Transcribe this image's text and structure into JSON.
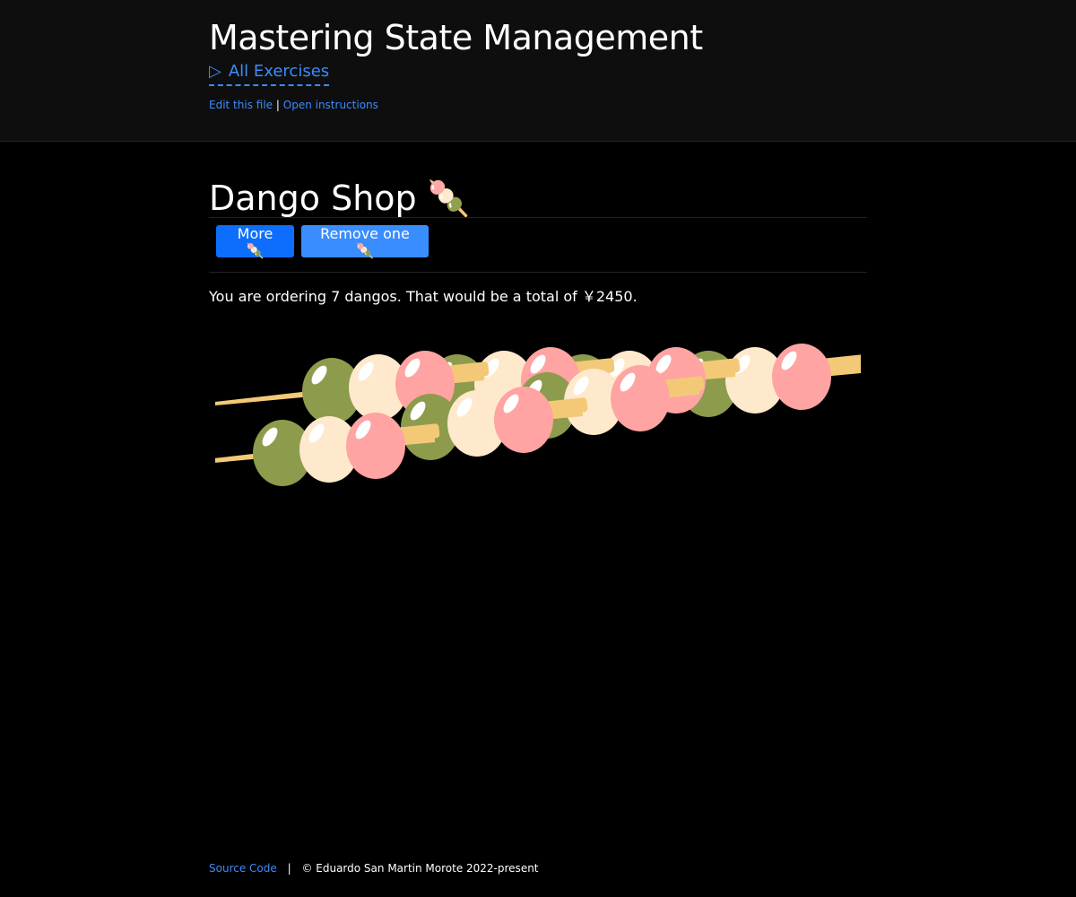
{
  "header": {
    "title": "Mastering State Management",
    "all_exercises_icon": "▷",
    "all_exercises_label": "All Exercises",
    "edit_link": "Edit this file",
    "separator": "|",
    "instructions_link": "Open instructions"
  },
  "main": {
    "title": "Dango Shop 🍡",
    "buttons": {
      "more_label": "More 🍡",
      "remove_label": "Remove one 🍡"
    },
    "order_text": "You are ordering 7 dangos. That would be a total of ￥2450.",
    "dango_count": 7,
    "colors": {
      "pink": "#ffa3a3",
      "white": "#ffe9cc",
      "green": "#8c9c4c",
      "stick": "#f3c978",
      "accent": "#0d6efd"
    }
  },
  "footer": {
    "source_link": "Source Code",
    "separator": "|",
    "copyright": "© Eduardo San Martin Morote 2022-present"
  }
}
